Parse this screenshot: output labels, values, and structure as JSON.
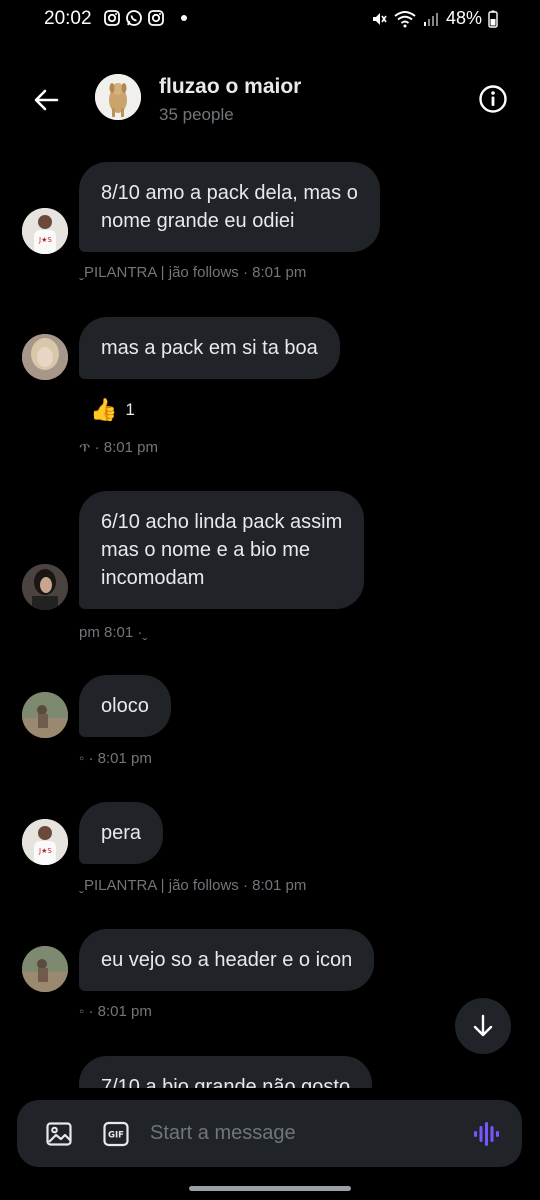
{
  "status_bar": {
    "time": "20:02",
    "battery": "48%",
    "left_icons": [
      "instagram-icon",
      "whatsapp-icon",
      "instagram-icon"
    ],
    "right_icons": [
      "mute-icon",
      "wifi-icon",
      "signal-icon",
      "battery-icon"
    ]
  },
  "header": {
    "title": "fluzao o maior",
    "subtitle": "35 people"
  },
  "messages": [
    {
      "lines": [
        "8/10 amo a pack dela, mas o",
        "nome grande eu odiei"
      ],
      "meta": "ˬPILANTRA | jão follows · 8:01 pm"
    },
    {
      "lines": [
        "mas a pack em si ta boa"
      ],
      "reaction_emoji": "👍",
      "reaction_count": "1",
      "meta": "ጥ · 8:01 pm"
    },
    {
      "lines": [
        "6/10 acho linda pack assim",
        "mas o nome e a bio me",
        "incomodam"
      ],
      "meta": "pm 8:01 ·ˬ"
    },
    {
      "lines": [
        "oloco"
      ],
      "meta": "◦ · 8:01 pm"
    },
    {
      "lines": [
        "pera"
      ],
      "meta": "ˬPILANTRA | jão follows · 8:01 pm"
    },
    {
      "lines": [
        "eu vejo so a header e o icon"
      ],
      "meta": "◦ · 8:01 pm"
    },
    {
      "lines": [
        "7/10 a bio grande não gosto"
      ]
    }
  ],
  "composer": {
    "placeholder": "Start a message"
  },
  "colors": {
    "background": "#000000",
    "bubble": "#202327",
    "text": "#e7e9ea",
    "muted": "#71767b",
    "voice_accent": "#7856ff"
  }
}
